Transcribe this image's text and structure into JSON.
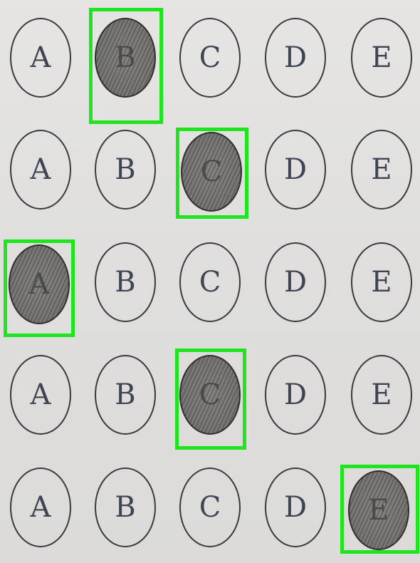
{
  "sheet": {
    "rows": [
      {
        "options": [
          "A",
          "B",
          "C",
          "D",
          "E"
        ],
        "marked": "B"
      },
      {
        "options": [
          "A",
          "B",
          "C",
          "D",
          "E"
        ],
        "marked": "C"
      },
      {
        "options": [
          "A",
          "B",
          "C",
          "D",
          "E"
        ],
        "marked": "A"
      },
      {
        "options": [
          "A",
          "B",
          "C",
          "D",
          "E"
        ],
        "marked": "C"
      },
      {
        "options": [
          "A",
          "B",
          "C",
          "D",
          "E"
        ],
        "marked": "E"
      }
    ]
  },
  "colors": {
    "highlight": "#1ee51e",
    "ink": "#3a3a3e",
    "paper": "#e2e1df"
  }
}
